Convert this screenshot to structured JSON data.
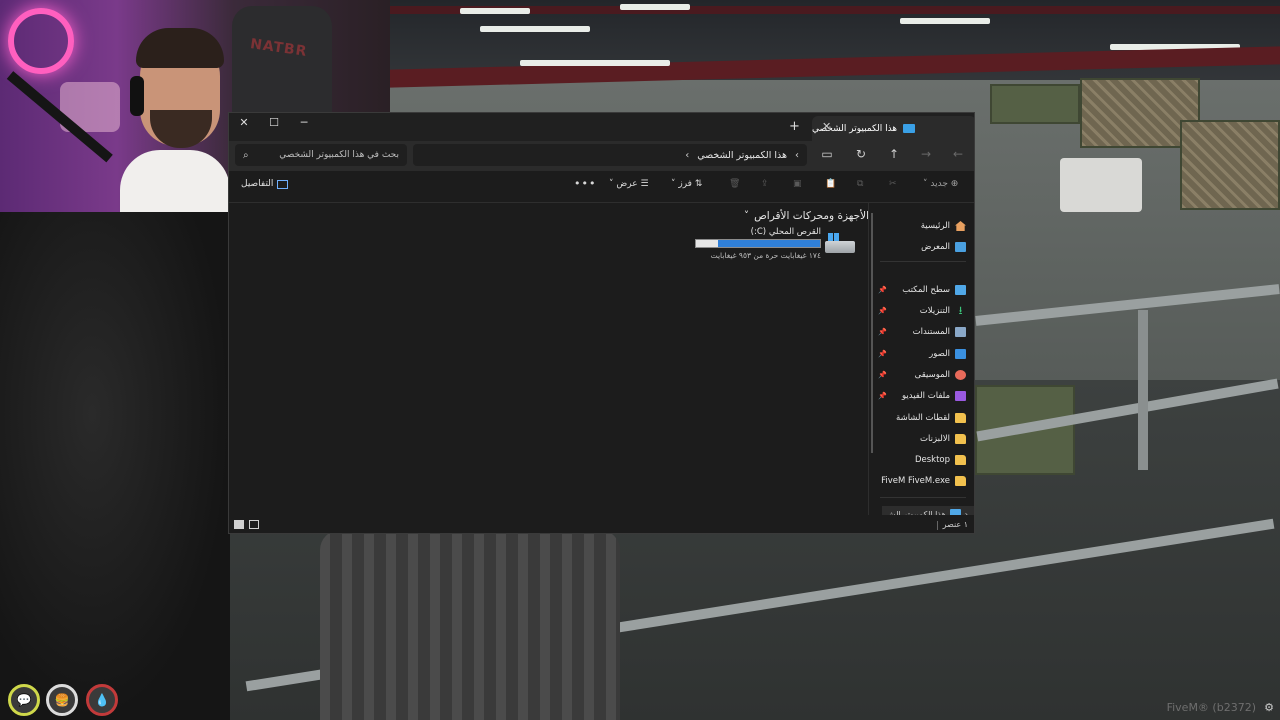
{
  "window": {
    "tab_title": "هذا الكمبيوتر الشخصي",
    "new_tab": "+",
    "close_tab": "✕",
    "controls": {
      "minimize": "─",
      "maximize": "☐",
      "close": "✕"
    }
  },
  "nav": {
    "back": "←",
    "forward": "→",
    "up": "↑",
    "refresh": "↻",
    "address": "هذا الكمبيوتر الشخصي",
    "search_placeholder": "بحث في هذا الكمبيوتر الشخصي"
  },
  "toolbar": {
    "new_label": "جديد",
    "sort_label": "فرز",
    "view_label": "عرض",
    "more": "•••",
    "details_label": "التفاصيل"
  },
  "main": {
    "group_header": "الأجهزة ومحركات الأقراص",
    "drive": {
      "name": "القرص المحلي (C:)",
      "free_text": "١٧٤ غيغابايت حرة من ٩٥٣ غيغابايت",
      "used_fraction": 0.82
    }
  },
  "sidebar": {
    "items": [
      {
        "label": "الرئيسية",
        "icon": "home-icon",
        "pinned": false
      },
      {
        "label": "المعرض",
        "icon": "gallery-icon",
        "pinned": false
      },
      {
        "label": "سطح المكتب",
        "icon": "desktop-icon",
        "pinned": true
      },
      {
        "label": "التنزيلات",
        "icon": "downloads-icon",
        "pinned": true
      },
      {
        "label": "المستندات",
        "icon": "documents-icon",
        "pinned": true
      },
      {
        "label": "الصور",
        "icon": "pictures-icon",
        "pinned": true
      },
      {
        "label": "الموسيقى",
        "icon": "music-icon",
        "pinned": true
      },
      {
        "label": "ملفات الفيديو",
        "icon": "videos-icon",
        "pinned": true
      },
      {
        "label": "لقطات الشاشة",
        "icon": "folder-icon",
        "pinned": false
      },
      {
        "label": "الالبزنات",
        "icon": "folder-icon",
        "pinned": false
      },
      {
        "label": "Desktop",
        "icon": "folder-icon",
        "pinned": false
      },
      {
        "label": "FiveM FiveM.exe",
        "icon": "folder-icon",
        "pinned": false
      }
    ],
    "this_pc": "هذا الكمبيوتر الش"
  },
  "status": {
    "count": "١ عنصر"
  },
  "overlay": {
    "watermark": "FiveM® (b2372)",
    "chair_text": "NATBR",
    "hud_chat": "💬",
    "hud_food": "🍔",
    "hud_water": "💧"
  },
  "colors": {
    "accent": "#2f7fd8",
    "folder": "#f2c14e",
    "window_bg": "#1c1c1c"
  }
}
